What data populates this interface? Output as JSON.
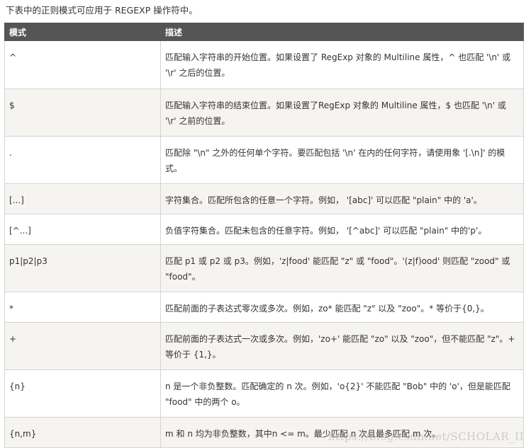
{
  "intro": "下表中的正则模式可应用于 REGEXP 操作符中。",
  "table": {
    "headers": [
      "模式",
      "描述"
    ],
    "rows": [
      {
        "pattern": "^",
        "desc": "匹配输入字符串的开始位置。如果设置了 RegExp 对象的 Multiline 属性，^ 也匹配 '\\n' 或 '\\r' 之后的位置。"
      },
      {
        "pattern": "$",
        "desc": "匹配输入字符串的结束位置。如果设置了RegExp 对象的 Multiline 属性，$ 也匹配 '\\n' 或 '\\r' 之前的位置。"
      },
      {
        "pattern": ".",
        "desc": "匹配除 \"\\n\" 之外的任何单个字符。要匹配包括 '\\n' 在内的任何字符，请使用象 '[.\\n]' 的模式。"
      },
      {
        "pattern": "[...]",
        "desc": "字符集合。匹配所包含的任意一个字符。例如， '[abc]' 可以匹配 \"plain\" 中的 'a'。"
      },
      {
        "pattern": "[^...]",
        "desc": "负值字符集合。匹配未包含的任意字符。例如， '[^abc]' 可以匹配 \"plain\" 中的'p'。"
      },
      {
        "pattern": "p1|p2|p3",
        "desc": "匹配 p1 或 p2 或 p3。例如，'z|food' 能匹配 \"z\" 或 \"food\"。'(z|f)ood' 则匹配 \"zood\" 或 \"food\"。"
      },
      {
        "pattern": "*",
        "desc": "匹配前面的子表达式零次或多次。例如，zo* 能匹配 \"z\" 以及 \"zoo\"。* 等价于{0,}。"
      },
      {
        "pattern": "+",
        "desc": "匹配前面的子表达式一次或多次。例如，'zo+' 能匹配 \"zo\" 以及 \"zoo\"，但不能匹配 \"z\"。+ 等价于 {1,}。"
      },
      {
        "pattern": "{n}",
        "desc": "n 是一个非负整数。匹配确定的 n 次。例如，'o{2}' 不能匹配 \"Bob\" 中的 'o'，但是能匹配 \"food\" 中的两个 o。"
      },
      {
        "pattern": "{n,m}",
        "desc": "m 和 n 均为非负整数，其中n <= m。最少匹配 n 次且最多匹配 m 次。"
      }
    ]
  },
  "watermark": "https://blog.csdn.net/SCHOLAR_II"
}
